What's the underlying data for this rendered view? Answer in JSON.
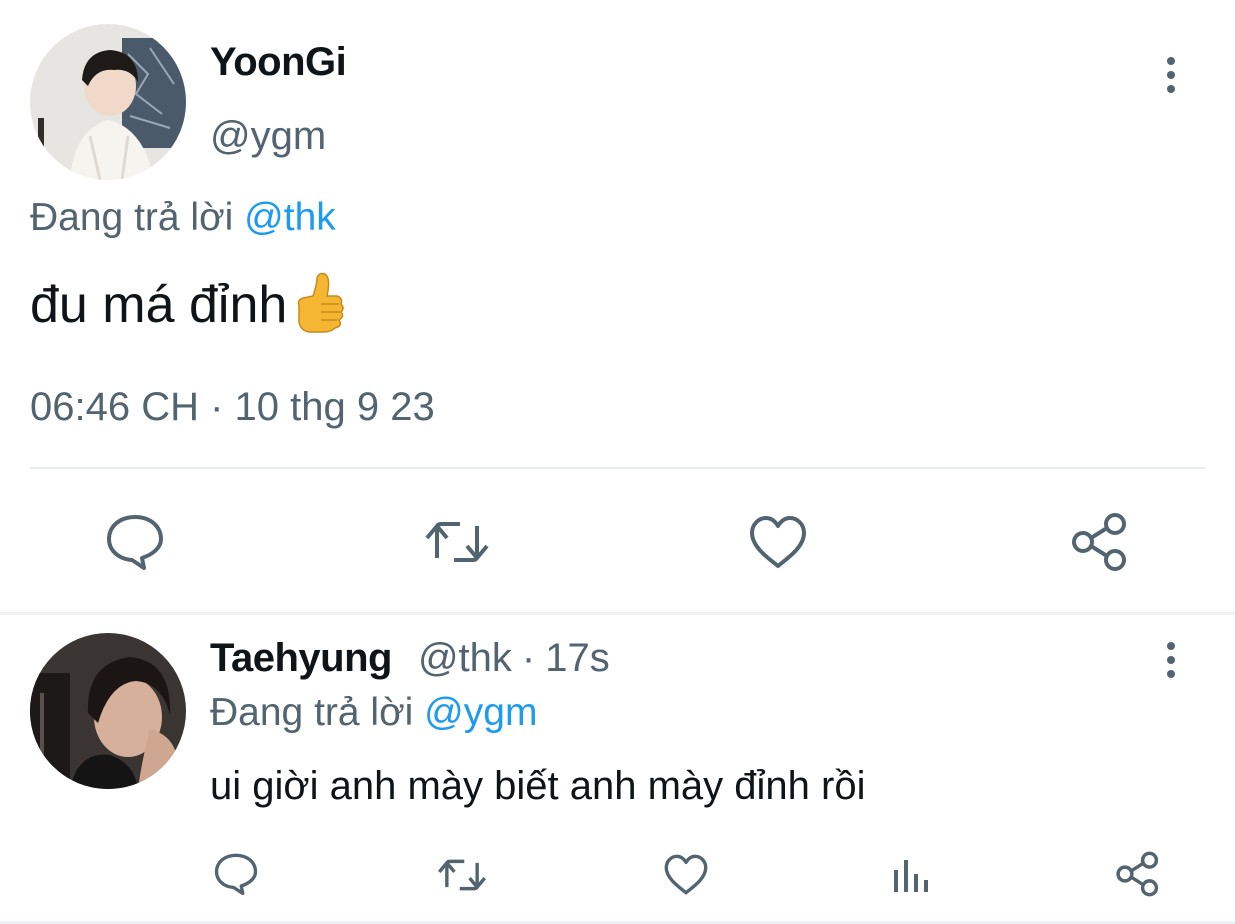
{
  "main_tweet": {
    "author_name": "YoonGi",
    "author_handle": "@ygm",
    "replying_label": "Đang trả lời ",
    "replying_to": "@thk",
    "text": "đu má đỉnh",
    "emoji": "thumbs-up",
    "timestamp": "06:46 CH · 10 thg 9 23",
    "actions": [
      "reply-icon",
      "retweet-icon",
      "like-icon",
      "share-icon"
    ]
  },
  "reply_tweet": {
    "author_name": "Taehyung",
    "author_handle": "@thk",
    "separator": "·",
    "time_ago": "17s",
    "replying_label": "Đang trả lời ",
    "replying_to": "@ygm",
    "text": "ui giời anh mày biết anh mày đỉnh rồi",
    "actions": [
      "reply-icon",
      "retweet-icon",
      "like-icon",
      "analytics-icon",
      "share-icon"
    ]
  },
  "colors": {
    "text_primary": "#0f1419",
    "text_secondary": "#536471",
    "link": "#1d9bf0",
    "divider": "#e6ecf0",
    "thumbs_up": "#f4b633"
  }
}
